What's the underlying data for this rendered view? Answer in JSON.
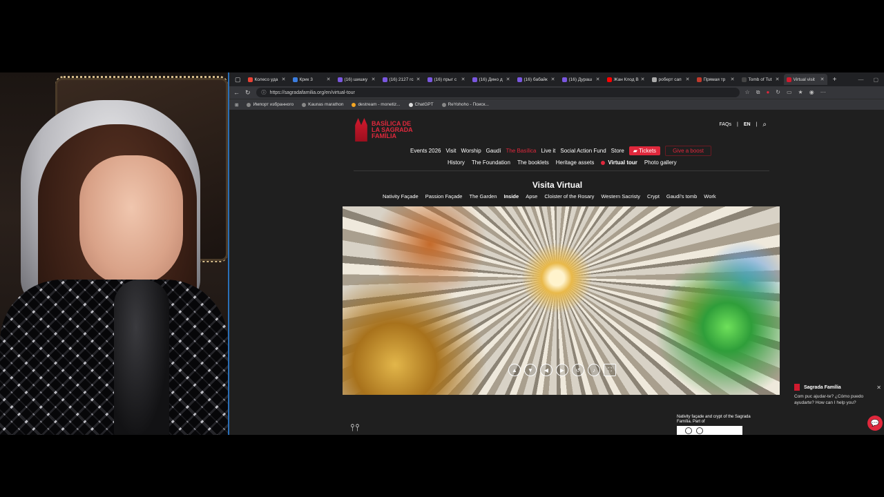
{
  "tabs": [
    {
      "label": "Колесо уда",
      "active": false
    },
    {
      "label": "Крик 3",
      "active": false
    },
    {
      "label": "(16) шишку",
      "active": false
    },
    {
      "label": "(16) 2127 гс",
      "active": false
    },
    {
      "label": "(16) прыг с",
      "active": false
    },
    {
      "label": "(16) Дино д",
      "active": false
    },
    {
      "label": "(16) бабайк",
      "active": false
    },
    {
      "label": "(16) Дураш",
      "active": false
    },
    {
      "label": "Жан Клод В",
      "active": false
    },
    {
      "label": "роберт сап",
      "active": false
    },
    {
      "label": "Прямая тр",
      "active": false
    },
    {
      "label": "Tomb of Tut",
      "active": false
    },
    {
      "label": "Virtual visit",
      "active": true
    }
  ],
  "url": "https://sagradafamilia.org/en/virtual-tour",
  "bookmarks": [
    "Импорт избранного",
    "Kaunas marathon",
    "destream - monetiz...",
    "ChatGPT",
    "ReYohoho - Поиск..."
  ],
  "site": {
    "logo_text": "BASÍLICA DE LA SAGRADA FAMÍLIA",
    "faqs": "FAQs",
    "lang": "EN",
    "main_nav": [
      "Events 2026",
      "Visit",
      "Worship",
      "Gaudí",
      "The Basílica",
      "Live it",
      "Social Action Fund",
      "Store"
    ],
    "tickets": "Tickets",
    "boost": "Give a boost",
    "sub_nav": [
      "History",
      "The Foundation",
      "The booklets",
      "Heritage assets",
      "Virtual tour",
      "Photo gallery"
    ],
    "title": "Visita Virtual",
    "tour_nav": [
      "Nativity Façade",
      "Passion Façade",
      "The Garden",
      "Inside",
      "Apse",
      "Cloister of the Rosary",
      "Western Sacristy",
      "Crypt",
      "Gaudí's tomb",
      "Work"
    ],
    "unesco_text": "Nativity façade and crypt of the Sagrada Família. Part of"
  },
  "chat": {
    "name": "Sagrada Família",
    "message": "Com puc ajudar-te? ¿Cómo puedo ayudarte? How can I help you?"
  }
}
